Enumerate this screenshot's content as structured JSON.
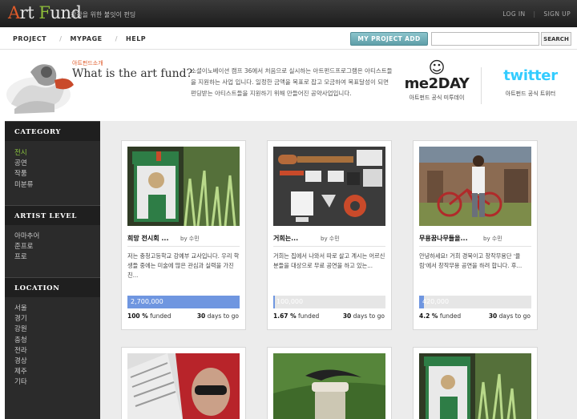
{
  "header": {
    "logo": {
      "a": "A",
      "rt": "rt",
      "f": "F",
      "und": "und"
    },
    "tagline": "창작을 위한 불잇이 펀딩",
    "login": "LOG IN",
    "signup": "SIGN UP"
  },
  "nav": {
    "items": [
      "PROJECT",
      "MYPAGE",
      "HELP"
    ],
    "my_project_add": "MY PROJECT ADD",
    "search_placeholder": "",
    "search_button": "SEARCH"
  },
  "banner": {
    "intro_small": "아트펀드소개",
    "intro_title": "What is the art fund?",
    "intro_desc": "소셜이노베이션 캠프 36에서 처음으로 실시하는 아트펀드프로그램은 아티스트들을 지원하는 사업 입니다. 일정한 금액을 목표로 잡고 모금하여 목표달성이 되면 펀딩받는 아티스트들을 지원하기 위해 만들어진 공약사업입니다.",
    "me2day": {
      "word": "me2DAY",
      "caption": "아트펀드 공식 미투데이"
    },
    "twitter": {
      "word": "twitter",
      "caption": "아트펀드 공식 트위터"
    }
  },
  "sidebar": {
    "category_title": "CATEGORY",
    "categories": [
      "전시",
      "공연",
      "작품",
      "미분류"
    ],
    "artist_level_title": "ARTIST LEVEL",
    "artist_levels": [
      "아마추어",
      "준프로",
      "프로"
    ],
    "location_title": "LOCATION",
    "locations": [
      "서울",
      "경기",
      "강원",
      "충청",
      "전라",
      "경상",
      "제주",
      "기타"
    ]
  },
  "projects": [
    {
      "title": "희망 전시회 ...",
      "by": "by 수민",
      "desc": "저는 충청고등학교 강예부 교사입니다. 우리 학생들 중에는 미술에 많은 관심과 실력을 가진 친...",
      "amount": "2,700,000",
      "progress": 1.0,
      "percent": "100 %",
      "funded_label": "funded",
      "days": "30",
      "days_label": "days to go"
    },
    {
      "title": "거희는...",
      "by": "by 수민",
      "desc": "거희는 집에서 나와서 따로 살고 계시는 어르신 분들을 대상으로 무료 공연을 하고 있는...",
      "amount": "100,000",
      "progress": 0.0167,
      "percent": "1.67 %",
      "funded_label": "funded",
      "days": "30",
      "days_label": "days to go"
    },
    {
      "title": "무용꿈나무들을...",
      "by": "by 수민",
      "desc": "안녕하세요! 거희 경북이고 창작무용단 '율림'에서 창작무용 공연을 하려 합니다. 후...",
      "amount": "420,000",
      "progress": 0.042,
      "percent": "4.2 %",
      "funded_label": "funded",
      "days": "30",
      "days_label": "days to go"
    }
  ],
  "colors": {
    "accent_green": "#8cc63f",
    "progress_blue": "#6f96e0",
    "button_teal": "#5e9ea8"
  }
}
